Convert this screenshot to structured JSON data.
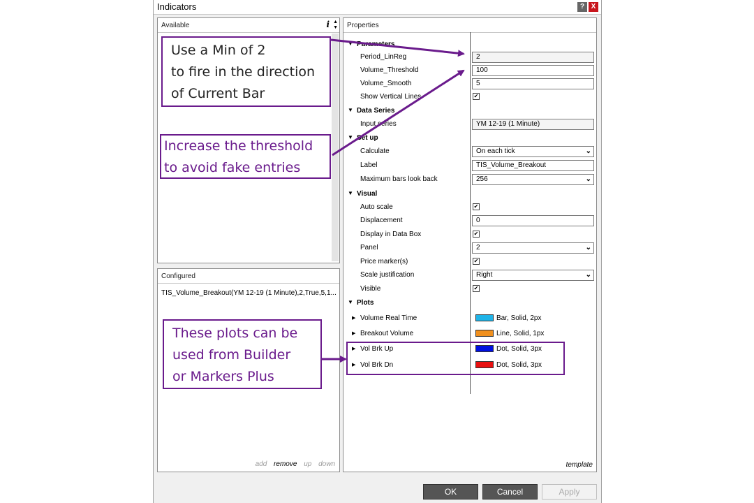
{
  "window": {
    "title": "Indicators",
    "help_label": "?",
    "close_label": "X"
  },
  "available": {
    "header": "Available",
    "info_label": "i",
    "spin_up": "▲",
    "spin_down": "▼"
  },
  "configured": {
    "header": "Configured",
    "item": "TIS_Volume_Breakout(YM 12-19 (1 Minute),2,True,5,1...",
    "actions": {
      "add": "add",
      "remove": "remove",
      "up": "up",
      "down": "down"
    }
  },
  "properties": {
    "header": "Properties",
    "categories": {
      "parameters": "Parameters",
      "data_series": "Data Series",
      "setup": "Set up",
      "visual": "Visual",
      "plots": "Plots"
    },
    "fields": {
      "period_linreg": {
        "label": "Period_LinReg",
        "value": "2"
      },
      "volume_threshold": {
        "label": "Volume_Threshold",
        "value": "100"
      },
      "volume_smooth": {
        "label": "Volume_Smooth",
        "value": "5"
      },
      "show_vertical_lines": {
        "label": "Show Vertical Lines",
        "value": "✔"
      },
      "input_series": {
        "label": "Input series",
        "value": "YM 12-19 (1 Minute)"
      },
      "calculate": {
        "label": "Calculate",
        "value": "On each tick"
      },
      "label": {
        "label": "Label",
        "value": "TIS_Volume_Breakout"
      },
      "max_bars_lookback": {
        "label": "Maximum bars look back",
        "value": "256"
      },
      "auto_scale": {
        "label": "Auto scale",
        "value": "✔"
      },
      "displacement": {
        "label": "Displacement",
        "value": "0"
      },
      "display_in_data_box": {
        "label": "Display in Data Box",
        "value": "✔"
      },
      "panel": {
        "label": "Panel",
        "value": "2"
      },
      "price_markers": {
        "label": "Price marker(s)",
        "value": "✔"
      },
      "scale_justification": {
        "label": "Scale justification",
        "value": "Right"
      },
      "visible": {
        "label": "Visible",
        "value": "✔"
      }
    },
    "plots": [
      {
        "label": "Volume Real Time",
        "value": "Bar, Solid, 2px",
        "color": "#1fb4e8"
      },
      {
        "label": "Breakout Volume",
        "value": "Line, Solid, 1px",
        "color": "#f0901e"
      },
      {
        "label": "Vol Brk Up",
        "value": "Dot, Solid, 3px",
        "color": "#0010e0"
      },
      {
        "label": "Vol Brk Dn",
        "value": "Dot, Solid, 3px",
        "color": "#e81010"
      }
    ],
    "template_label": "template"
  },
  "buttons": {
    "ok": "OK",
    "cancel": "Cancel",
    "apply": "Apply"
  },
  "annotations": {
    "note1": [
      "Use a Min of 2",
      "to fire in the direction",
      "of Current Bar"
    ],
    "note2": [
      "Increase the threshold",
      "to avoid fake entries"
    ],
    "note3": [
      "These plots can be",
      "used from Builder",
      "or Markers Plus"
    ],
    "color": "#6a1b8c"
  }
}
